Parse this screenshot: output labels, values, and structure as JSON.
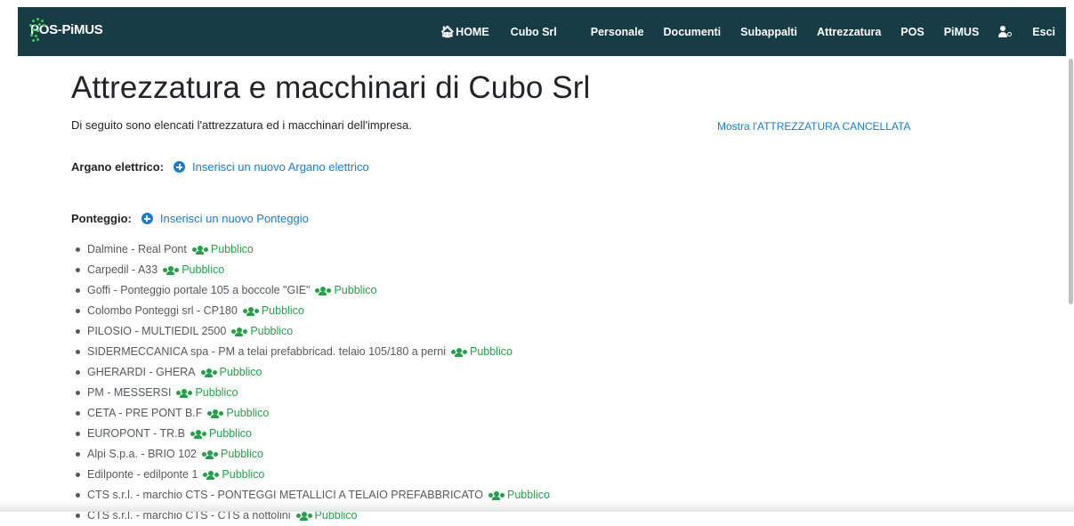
{
  "navbar": {
    "brand": "POS-PiMUS",
    "items": [
      "HOME",
      "Cubo Srl",
      "Personale",
      "Documenti",
      "Subappalti",
      "Attrezzatura",
      "POS",
      "PiMUS",
      "Esci"
    ]
  },
  "page": {
    "title": "Attrezzatura e macchinari di Cubo Srl",
    "intro": "Di seguito sono elencati l'attrezzatura ed i macchinari dell'impresa.",
    "show_deleted": "Mostra l'ATTREZZATURA CANCELLATA"
  },
  "sections": [
    {
      "label": "Argano elettrico:",
      "add_link": "Inserisci un nuovo Argano elettrico"
    },
    {
      "label": "Ponteggio:",
      "add_link": "Inserisci un nuovo Ponteggio"
    }
  ],
  "public_label": "Pubblico",
  "ponteggi": [
    "Dalmine - Real Pont",
    "Carpedil - A33",
    "Goffi - Ponteggio portale 105 a boccole \"GIE\"",
    "Colombo Ponteggi srl - CP180",
    "PILOSIO - MULTIEDIL 2500",
    "SIDERMECCANICA spa - PM a telai prefabbricad. telaio 105/180 a perni",
    "GHERARDI - GHERA",
    "PM - MESSERSI",
    "CETA - PRE PONT B.F",
    "EUROPONT - TR.B",
    "Alpi S.p.a. - BRIO 102",
    "Edilponte - edilponte 1",
    "CTS s.r.l. - marchio CTS - PONTEGGI METALLICI A TELAIO PREFABBRICATO",
    "CTS s.r.l. - marchio CTS - CTS a nottolini"
  ],
  "colors": {
    "navbar": "#173c45",
    "link": "#0d7fe0",
    "public": "#22a246",
    "brand_dots": "#3fcf55"
  },
  "icons": {
    "home": "home-icon",
    "user_settings": "user-cog-icon",
    "add": "plus-circle-icon",
    "public": "users-icon"
  }
}
